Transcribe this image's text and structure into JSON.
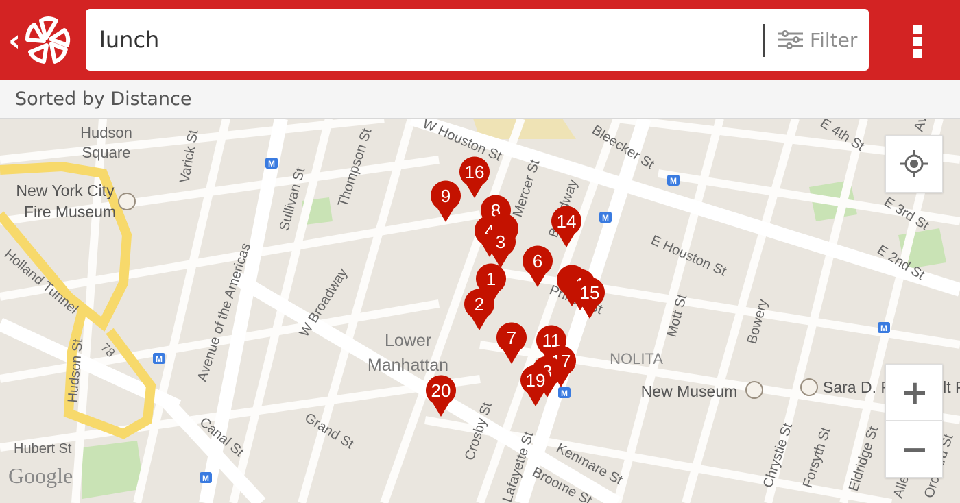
{
  "header": {
    "back_icon": "chevron-left-icon",
    "logo_icon": "yelp-burst-logo",
    "search_value": "lunch",
    "filter_icon": "sliders-icon",
    "filter_label": "Filter",
    "menu_icon": "vertical-dots-icon"
  },
  "sortbar": {
    "label": "Sorted by Distance"
  },
  "map": {
    "attribution": "Google",
    "locate_icon": "crosshair-icon",
    "zoom_in_label": "+",
    "zoom_out_label": "−",
    "labels": {
      "hudson_square": [
        "Hudson",
        "Square"
      ],
      "fire_museum": [
        "New York City",
        "Fire Museum"
      ],
      "lower_manhattan": [
        "Lower",
        "Manhattan"
      ],
      "nolita": "NOLITA",
      "new_museum": "New Museum",
      "sara_d": "Sara D. Roosevelt P",
      "varick": "Varick St",
      "sullivan": "Sullivan St",
      "thompson": "Thompson St",
      "w_houston": "W Houston St",
      "bleecker": "Bleecker St",
      "e_4th": "E 4th St",
      "e_3rd": "E 3rd St",
      "e_2nd": "E 2nd St",
      "e_houston": "E Houston St",
      "mott": "Mott St",
      "bowery": "Bowery",
      "holland": "Holland Tunnel",
      "avenue_americas": "Avenue of the Americas",
      "w_broadway": "W Broadway",
      "hudson_st": "Hudson St",
      "route_78": "78",
      "hubert": "Hubert St",
      "canal": "Canal St",
      "grand": "Grand St",
      "crosby": "Crosby St",
      "lafayette": "Lafayette St",
      "broome": "Broome St",
      "kenmare": "Kenmare St",
      "chrystie": "Chrystie St",
      "forsyth": "Forsyth St",
      "eldridge": "Eldridge St",
      "allen": "Allen St",
      "orchard": "Orchard St",
      "broadway": "Broadway",
      "mercer": "Mercer St",
      "prince": "Prince St",
      "ave": "Ave",
      "metro": "M"
    },
    "pins": [
      {
        "n": "16"
      },
      {
        "n": "9"
      },
      {
        "n": "8"
      },
      {
        "n": ""
      },
      {
        "n": "4"
      },
      {
        "n": "3"
      },
      {
        "n": "14"
      },
      {
        "n": "6"
      },
      {
        "n": "1"
      },
      {
        "n": ""
      },
      {
        "n": "1"
      },
      {
        "n": "15"
      },
      {
        "n": "2"
      },
      {
        "n": "7"
      },
      {
        "n": "11"
      },
      {
        "n": "17"
      },
      {
        "n": "3"
      },
      {
        "n": "19"
      },
      {
        "n": "20"
      }
    ]
  }
}
